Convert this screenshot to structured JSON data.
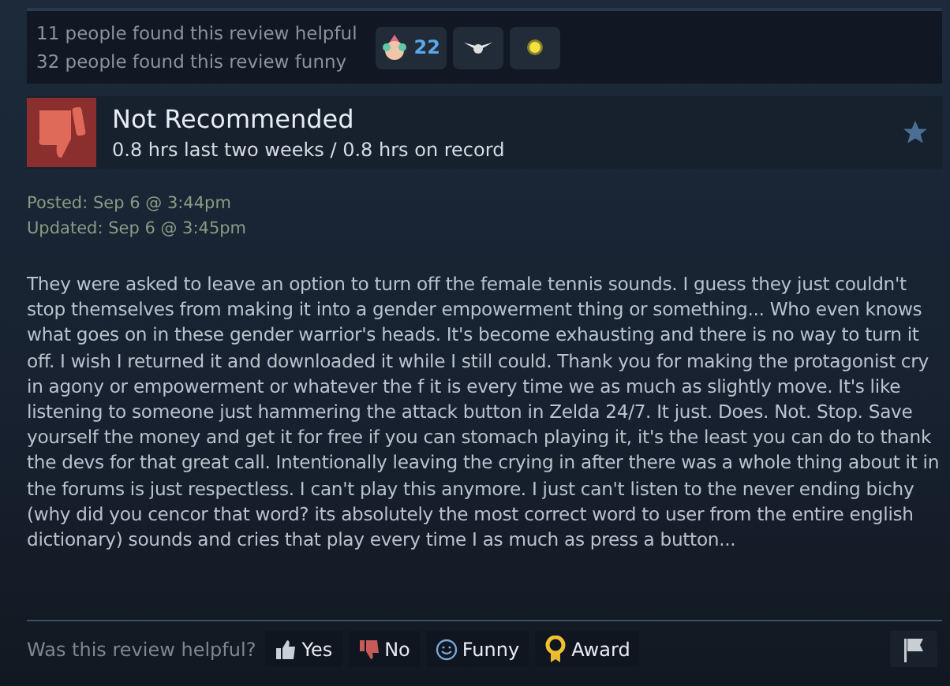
{
  "votes": {
    "helpful": "11 people found this review helpful",
    "funny": "32 people found this review funny"
  },
  "awards": [
    {
      "kind": "clown",
      "count": "22"
    },
    {
      "kind": "wings"
    },
    {
      "kind": "sun"
    }
  ],
  "review": {
    "verdict": "Not Recommended",
    "hours": "0.8 hrs last two weeks / 0.8 hrs on record",
    "posted": "Posted: Sep 6 @ 3:44pm",
    "updated": "Updated: Sep 6 @ 3:45pm",
    "body": "They were asked to leave an option to turn off the female tennis sounds. I guess they just couldn't stop themselves from making it into a gender empowerment thing or something... Who even knows what goes on in these gender warrior's heads. It's become exhausting and there is no way to turn it off. I wish I returned it and downloaded it while I still could. Thank you for making the protagonist cry in agony or empowerment or whatever the f it is every time we as much as slightly move. It's like listening to someone just hammering the attack button in Zelda 24/7. It just. Does. Not. Stop. Save yourself the money and get it for free if you can stomach playing it, it's the least you can do to thank the devs for that great call. Intentionally leaving the crying in after there was a whole thing about it in the forums is just respectless. I can't play this anymore. I just can't listen to the never ending bichy (why did you cencor that word? its absolutely the most correct word to user from the entire english dictionary) sounds and cries that play every time I as much as press a button..."
  },
  "feedback": {
    "prompt": "Was this review helpful?",
    "buttons": [
      {
        "kind": "yes",
        "label": "Yes"
      },
      {
        "kind": "no",
        "label": "No"
      },
      {
        "kind": "funny",
        "label": "Funny"
      },
      {
        "kind": "award",
        "label": "Award"
      }
    ]
  }
}
